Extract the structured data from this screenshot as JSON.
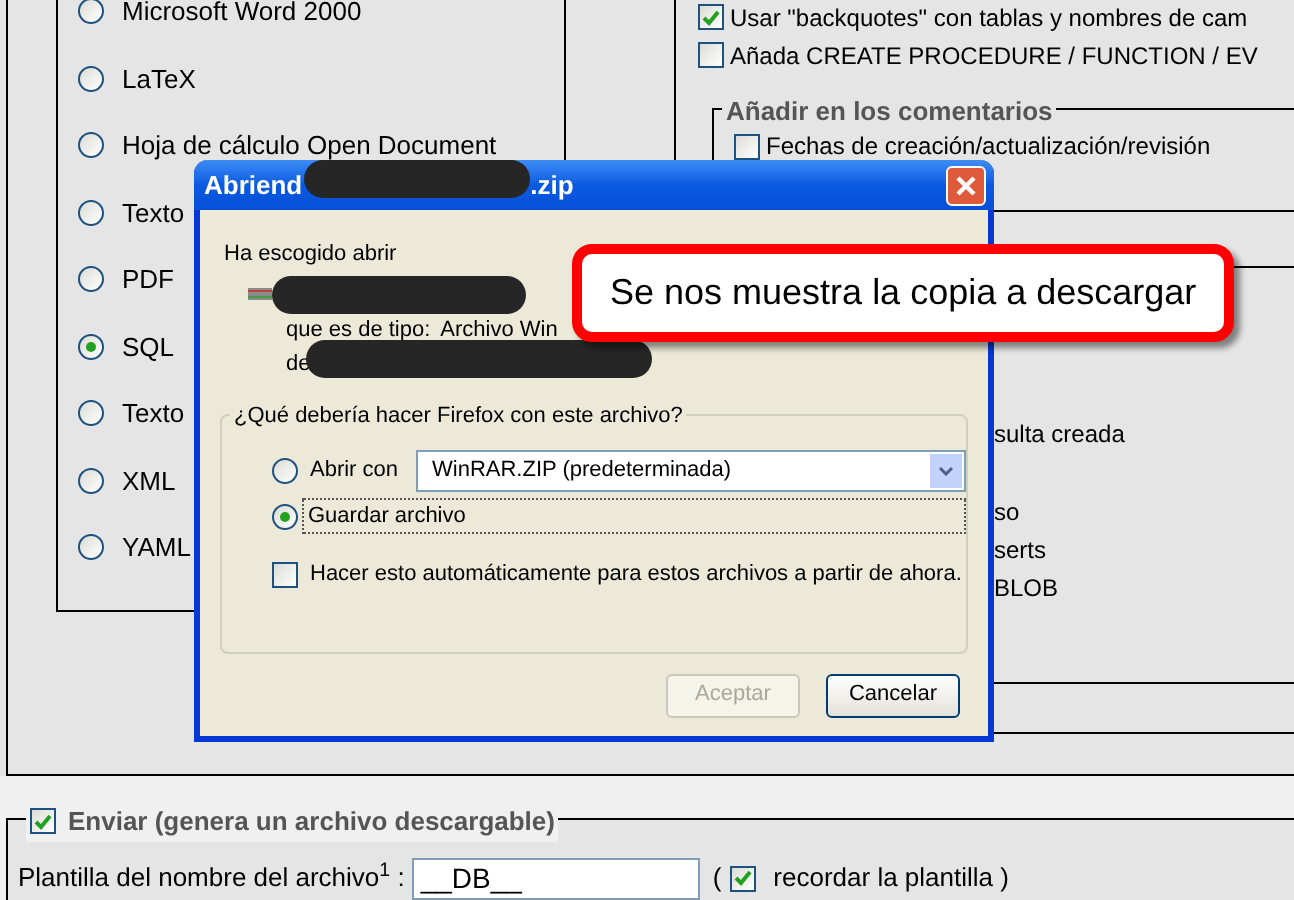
{
  "export_formats": {
    "options": [
      {
        "label": "Microsoft Word 2000",
        "selected": false
      },
      {
        "label": "LaTeX",
        "selected": false
      },
      {
        "label": "Hoja de cálculo Open Document",
        "selected": false
      },
      {
        "label": "Texto",
        "selected": false
      },
      {
        "label": "PDF",
        "selected": false
      },
      {
        "label": "SQL",
        "selected": true
      },
      {
        "label": "Texto",
        "selected": false
      },
      {
        "label": "XML",
        "selected": false
      },
      {
        "label": "YAML",
        "selected": false
      }
    ]
  },
  "sql_options": {
    "checkboxes": [
      {
        "label": "Usar \"backquotes\" con tablas y nombres de cam",
        "checked": true
      },
      {
        "label": "Añada CREATE PROCEDURE / FUNCTION / EV",
        "checked": false
      }
    ],
    "comments_group": {
      "legend": "Añadir en los comentarios",
      "checkboxes": [
        {
          "label": "Fechas de creación/actualización/revisión",
          "checked": false
        }
      ]
    },
    "partial_texts": [
      "sulta creada",
      "so",
      "serts",
      "BLOB"
    ]
  },
  "dialog": {
    "title_start": "Abriend",
    "title_end": ".zip",
    "intro": "Ha escogido abrir",
    "type_label": "que es de tipo:",
    "type_value": "Archivo Win",
    "from_label": "de",
    "group_legend": "¿Qué debería hacer Firefox con este archivo?",
    "options": [
      {
        "kind": "radio_select",
        "label": "Abrir con",
        "selected": false,
        "select_value": "WinRAR.ZIP (predeterminada)"
      },
      {
        "kind": "radio",
        "label": "Guardar archivo",
        "selected": true
      }
    ],
    "auto_checkbox": {
      "label": "Hacer esto automáticamente para estos archivos a partir de ahora.",
      "checked": false
    },
    "buttons": [
      {
        "label": "Aceptar",
        "disabled": true
      },
      {
        "label": "Cancelar",
        "disabled": false
      }
    ]
  },
  "callout": {
    "text": "Se nos muestra la copia a descargar"
  },
  "send": {
    "checked": true,
    "legend": "Enviar (genera un archivo descargable)",
    "filename_label": "Plantilla del nombre del archivo$^{1}$ :",
    "filename_value": "__DB__",
    "open_paren": "(",
    "remember": {
      "checked": true,
      "label": "recordar la plantilla )"
    }
  }
}
